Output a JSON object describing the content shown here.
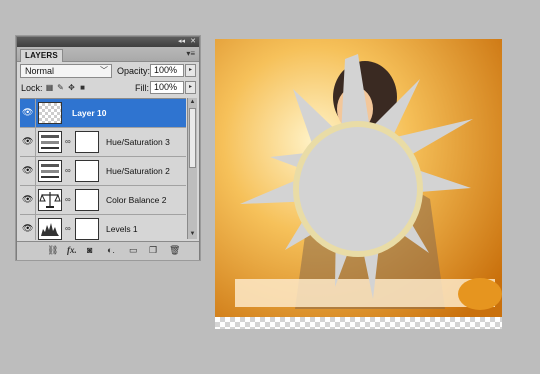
{
  "panel": {
    "tab_label": "LAYERS",
    "collapse_glyph": "◂◂",
    "close_glyph": "✕",
    "menu_glyph": "▾≡",
    "blend_mode": "Normal",
    "opacity_label": "Opacity:",
    "opacity_value": "100%",
    "lock_label": "Lock:",
    "fill_label": "Fill:",
    "fill_value": "100%",
    "arrow_glyph": "▸",
    "chev_glyph": "﹀"
  },
  "lock_icons": [
    "lock-transparent-icon",
    "lock-paint-icon",
    "lock-move-icon",
    "lock-all-icon"
  ],
  "layers": [
    {
      "name": "Layer 10",
      "selected": true,
      "thumb": "transparent",
      "has_mask": false
    },
    {
      "name": "Hue/Saturation 3",
      "selected": false,
      "thumb": "hue-saturation-icon",
      "has_mask": true
    },
    {
      "name": "Hue/Saturation 2",
      "selected": false,
      "thumb": "hue-saturation-icon",
      "has_mask": true
    },
    {
      "name": "Color Balance 2",
      "selected": false,
      "thumb": "color-balance-icon",
      "has_mask": true
    },
    {
      "name": "Levels 1",
      "selected": false,
      "thumb": "levels-icon",
      "has_mask": true
    }
  ],
  "footer_icons": [
    "link-layers-icon",
    "fx-icon",
    "add-mask-icon",
    "adjustment-layer-icon",
    "group-icon",
    "new-layer-icon",
    "trash-icon"
  ],
  "colors": {
    "selection": "#2f74d0",
    "shape_fill": "#d3d3d3",
    "canvas_warm": "#f2a935"
  },
  "canvas": {
    "content": "image-with-sun-burst-shape"
  }
}
